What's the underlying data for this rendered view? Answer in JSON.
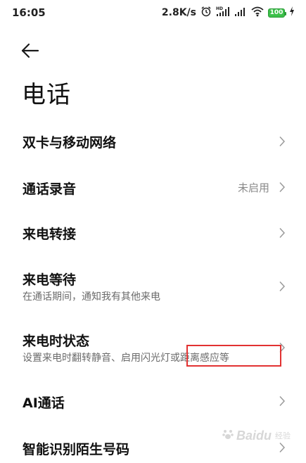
{
  "status_bar": {
    "time": "16:05",
    "net_speed": "2.8K/s",
    "battery_level": "100",
    "icons": [
      "alarm-icon",
      "hd-signal-icon",
      "signal-icon",
      "wifi-icon",
      "battery-icon",
      "charging-icon"
    ]
  },
  "header": {
    "title": "电话"
  },
  "settings": {
    "items": [
      {
        "title": "双卡与移动网络"
      },
      {
        "title": "通话录音",
        "value": "未启用"
      },
      {
        "title": "来电转接"
      },
      {
        "title": "来电等待",
        "subtitle": "在通话期间，通知我有其他来电"
      },
      {
        "title": "来电时状态",
        "subtitle": "设置来电时翻转静音、启用闪光灯或距离感应等"
      },
      {
        "title": "AI通话"
      },
      {
        "title": "智能识别陌生号码"
      }
    ]
  },
  "watermark": {
    "brand": "Baidu",
    "sub": "经验"
  },
  "colors": {
    "annotation": "#e23232",
    "battery": "#3cc04a"
  }
}
